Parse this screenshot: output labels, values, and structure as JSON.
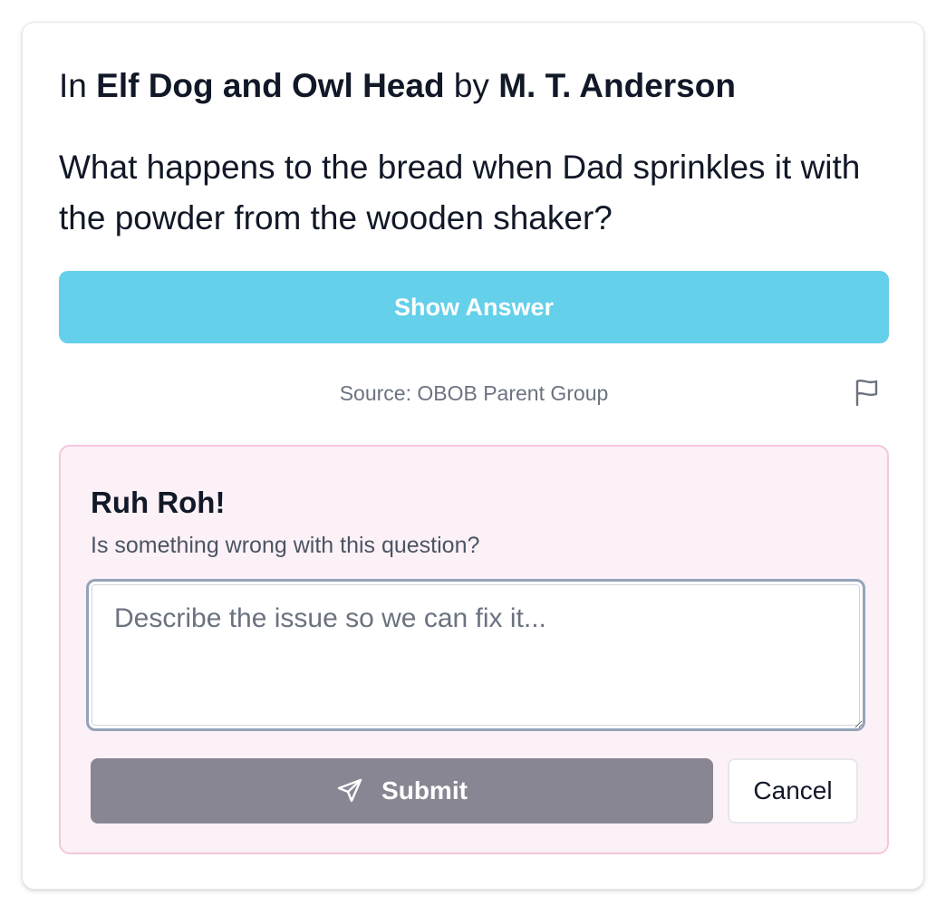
{
  "card": {
    "prefix": "In",
    "book_title": "Elf Dog and Owl Head",
    "by": "by",
    "author": "M. T. Anderson",
    "question": "What happens to the bread when Dad sprinkles it with the powder from the wooden shaker?",
    "show_answer_label": "Show Answer",
    "source": "Source: OBOB Parent Group",
    "flag_icon": "flag-icon"
  },
  "report": {
    "title": "Ruh Roh!",
    "subtitle": "Is something wrong with this question?",
    "placeholder": "Describe the issue so we can fix it...",
    "value": "",
    "submit_label": "Submit",
    "submit_icon": "send-icon",
    "cancel_label": "Cancel"
  },
  "colors": {
    "accent": "#64d0ea",
    "report_background": "#fcf1f7",
    "report_border": "#f4c6dd",
    "submit_background": "#898693"
  }
}
